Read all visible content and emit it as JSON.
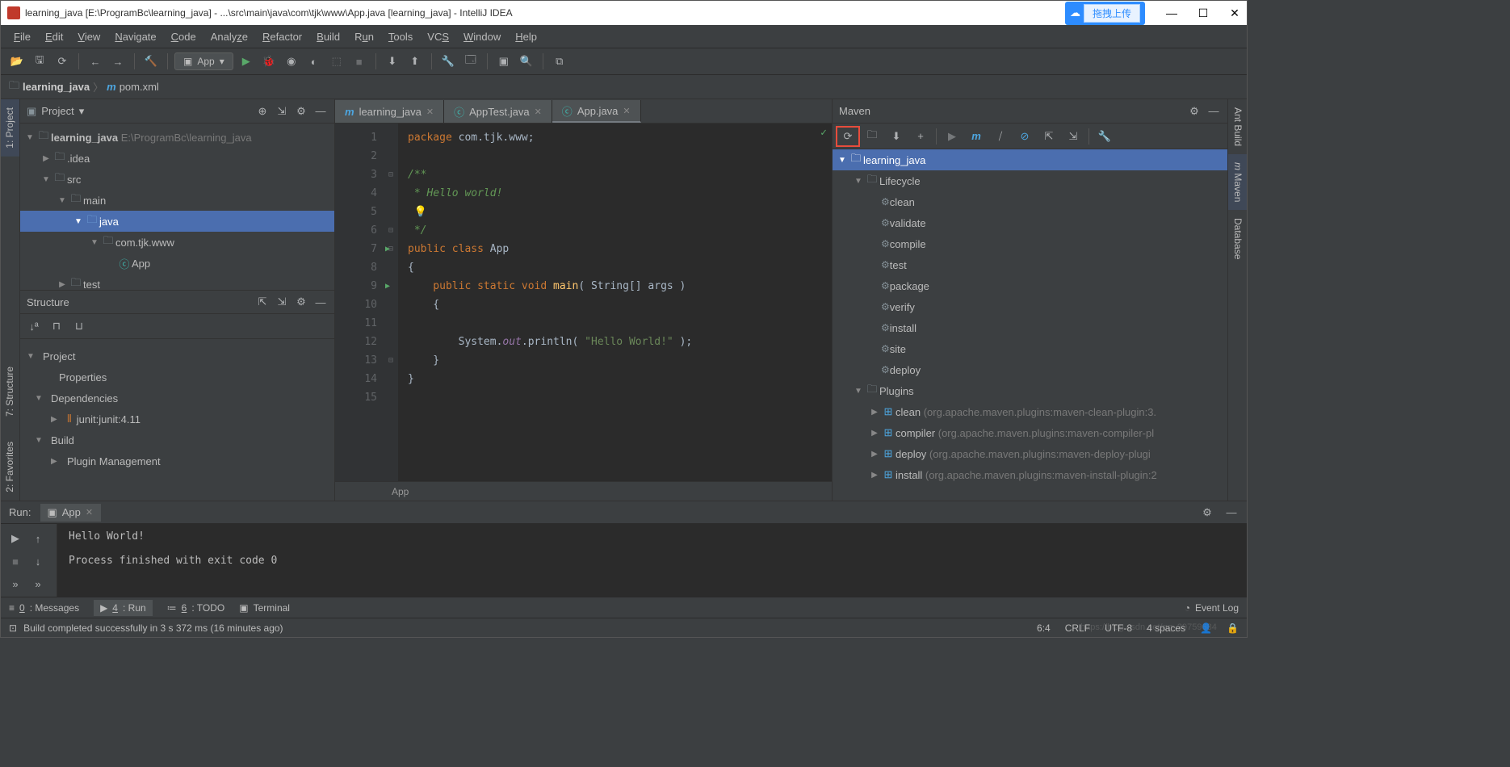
{
  "title_bar": {
    "text": "learning_java [E:\\ProgramBc\\learning_java] - ...\\src\\main\\java\\com\\tjk\\www\\App.java [learning_java] - IntelliJ IDEA",
    "cloud_label": "拖拽上传"
  },
  "menu": [
    "File",
    "Edit",
    "View",
    "Navigate",
    "Code",
    "Analyze",
    "Refactor",
    "Build",
    "Run",
    "Tools",
    "VCS",
    "Window",
    "Help"
  ],
  "toolbar": {
    "run_config": "App"
  },
  "nav": {
    "root": "learning_java",
    "file": "pom.xml"
  },
  "side_left": {
    "project_tab": "1: Project",
    "structure_tab": "7: Structure",
    "favorites_tab": "2: Favorites"
  },
  "side_right": {
    "ant_tab": "Ant Build",
    "maven_tab": "Maven",
    "database_tab": "Database"
  },
  "project_panel": {
    "title": "Project",
    "tree": {
      "root": "learning_java",
      "root_path": "E:\\ProgramBc\\learning_java",
      "idea": ".idea",
      "src": "src",
      "main": "main",
      "java": "java",
      "pkg": "com.tjk.www",
      "app": "App",
      "test": "test"
    }
  },
  "structure_panel": {
    "title": "Structure",
    "project": "Project",
    "properties": "Properties",
    "dependencies": "Dependencies",
    "junit": "junit:junit:4.11",
    "build": "Build",
    "plugin_mgmt": "Plugin Management"
  },
  "editor": {
    "tabs": [
      {
        "icon": "m",
        "label": "learning_java"
      },
      {
        "icon": "j",
        "label": "AppTest.java"
      },
      {
        "icon": "j",
        "label": "App.java",
        "active": true
      }
    ],
    "breadcrumb": "App",
    "lines": [
      "1",
      "2",
      "3",
      "4",
      "5",
      "6",
      "7",
      "8",
      "9",
      "10",
      "11",
      "12",
      "13",
      "14",
      "15"
    ],
    "code": {
      "l1a": "package ",
      "l1b": "com.tjk.www",
      "l1c": ";",
      "l3": "/**",
      "l4": " * Hello world!",
      "l6": " */",
      "l7a": "public class ",
      "l7b": "App",
      "l8": "{",
      "l9a": "    public static void ",
      "l9b": "main",
      "l9c": "( String[] args )",
      "l10": "    {",
      "l12a": "        System.",
      "l12b": "out",
      "l12c": ".println( ",
      "l12d": "\"Hello World!\"",
      "l12e": " );",
      "l13": "    }",
      "l14": "}"
    }
  },
  "maven_panel": {
    "title": "Maven",
    "root": "learning_java",
    "lifecycle": "Lifecycle",
    "goals": [
      "clean",
      "validate",
      "compile",
      "test",
      "package",
      "verify",
      "install",
      "site",
      "deploy"
    ],
    "plugins": "Plugins",
    "plugin_items": [
      {
        "name": "clean",
        "hint": "(org.apache.maven.plugins:maven-clean-plugin:3."
      },
      {
        "name": "compiler",
        "hint": "(org.apache.maven.plugins:maven-compiler-pl"
      },
      {
        "name": "deploy",
        "hint": "(org.apache.maven.plugins:maven-deploy-plugi"
      },
      {
        "name": "install",
        "hint": "(org.apache.maven.plugins:maven-install-plugin:2"
      }
    ]
  },
  "run_panel": {
    "label": "Run:",
    "tab": "App",
    "output": "Hello World!\n\nProcess finished with exit code 0"
  },
  "bottom_tabs": {
    "messages": "0: Messages",
    "run": "4: Run",
    "todo": "6: TODO",
    "terminal": "Terminal",
    "event_log": "Event Log"
  },
  "status": {
    "build_msg": "Build completed successfully in 3 s 372 ms (16 minutes ago)",
    "pos": "6:4",
    "crlf": "CRLF",
    "enc": "UTF-8",
    "indent": "4 spaces",
    "watermark": "https://blog.csdn.net/qq_39759684"
  }
}
